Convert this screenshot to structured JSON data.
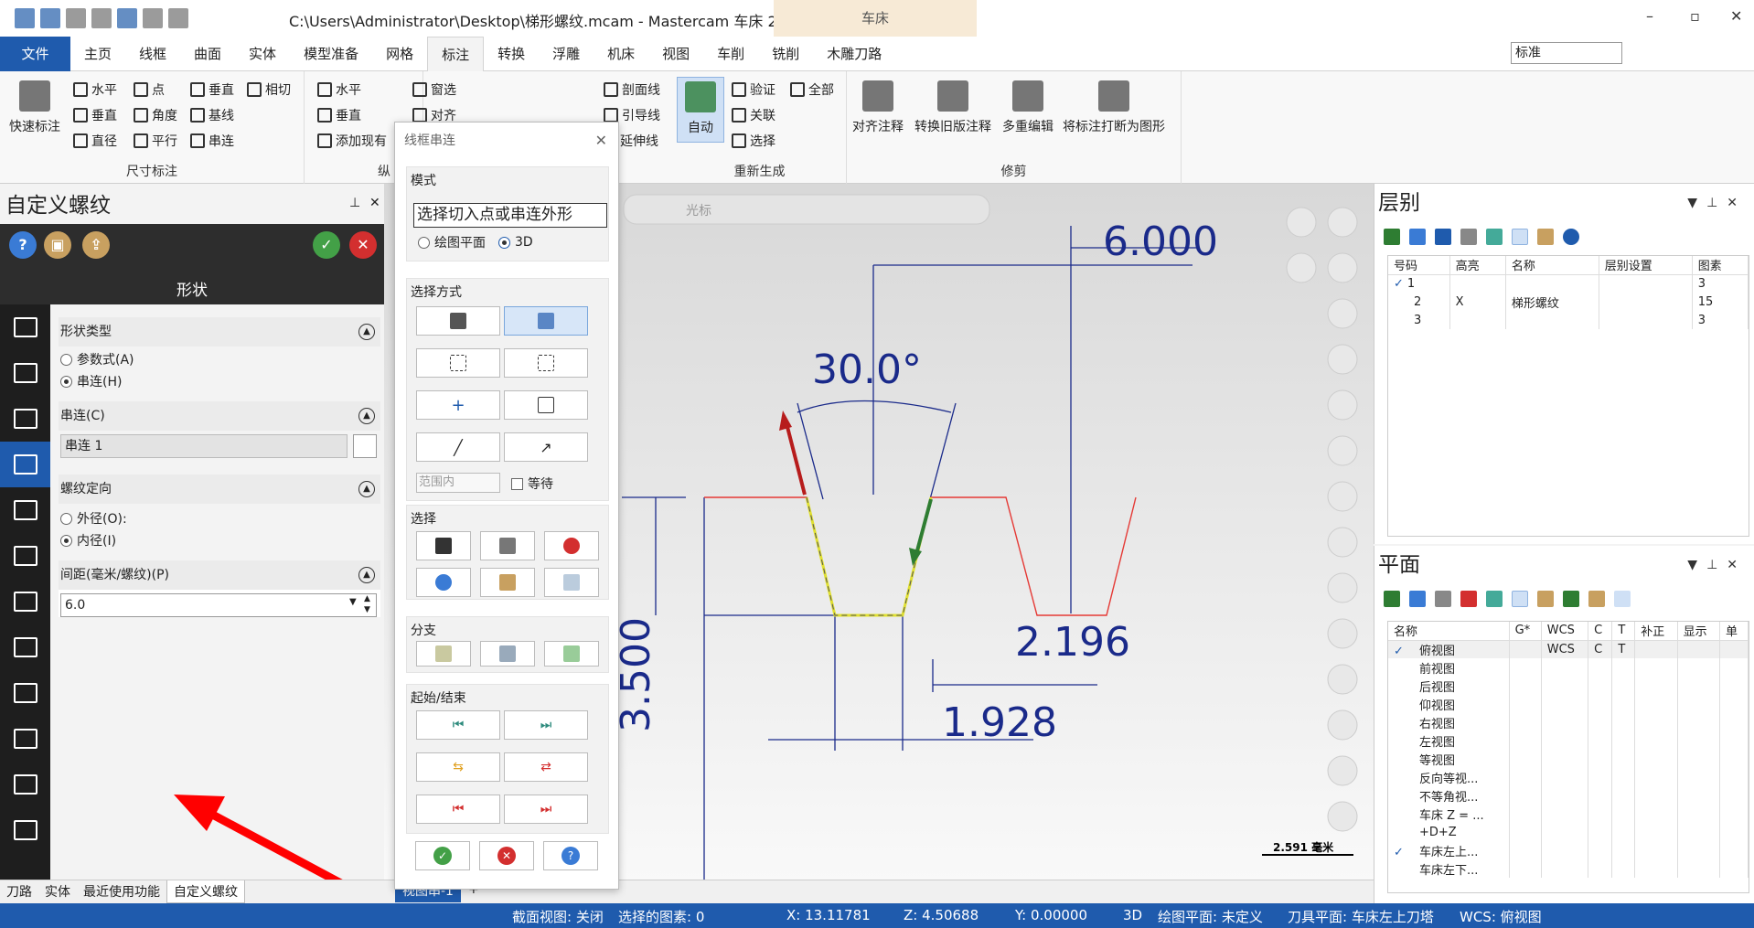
{
  "window": {
    "title": "C:\\Users\\Administrator\\Desktop\\梯形螺纹.mcam - Mastercam 车床 2025",
    "context_tab": "车床",
    "minimize": "–",
    "restore": "▫",
    "close": "✕"
  },
  "ribbon_tabs": [
    "文件",
    "主页",
    "线框",
    "曲面",
    "实体",
    "模型准备",
    "网格",
    "标注",
    "转换",
    "浮雕",
    "机床",
    "视图",
    "车削",
    "铣削",
    "木雕刀路"
  ],
  "active_tab": "标注",
  "style_select": "标准",
  "ribbon": {
    "quick_dim": "快速标注",
    "dims": [
      "水平",
      "点",
      "垂直",
      "相切",
      "垂直",
      "角度",
      "基线",
      "直径",
      "平行",
      "串连"
    ],
    "dim_group": "尺寸标注",
    "vert_items": [
      "水平",
      "垂直",
      "添加现有"
    ],
    "vert_group_partial": "纵",
    "window_items": [
      "窗选",
      "对齐"
    ],
    "section_items": [
      "剖面线",
      "引导线",
      "延伸线"
    ],
    "regen": {
      "auto": "自动",
      "items": [
        "验证",
        "全部",
        "关联",
        "选择"
      ],
      "group": "重新生成"
    },
    "trim": {
      "items": [
        "对齐注释",
        "转换旧版注释",
        "多重编辑",
        "将标注打断为图形"
      ],
      "group": "修剪"
    }
  },
  "left_panel": {
    "header": "自定义螺纹",
    "pin": "⊥",
    "close": "✕",
    "title": "形状",
    "shape_type": {
      "label": "形状类型",
      "options": [
        "参数式(A)",
        "串连(H)"
      ],
      "selected": 1
    },
    "chain": {
      "label": "串连(C)",
      "value": "串连 1"
    },
    "thread_dir": {
      "label": "螺纹定向",
      "options": [
        "外径(O):",
        "内径(I)"
      ],
      "selected": 1
    },
    "pitch": {
      "label": "间距(毫米/螺纹)(P)",
      "value": "6.0"
    }
  },
  "bottom_tabs": [
    "刀路",
    "实体",
    "最近使用功能",
    "自定义螺纹"
  ],
  "viewsheet_tab": "视图串-1",
  "dialog": {
    "title": "线框串连",
    "mode_label": "模式",
    "tooltip": "选择切入点或串连外形",
    "plane_options": [
      "绘图平面",
      "3D"
    ],
    "select_method_label": "选择方式",
    "range": "范围内",
    "wait": "等待",
    "select_label": "选择",
    "branch_label": "分支",
    "start_end_label": "起始/结束"
  },
  "viewport": {
    "toolbar_cursor": "光标",
    "dims": {
      "top": "6.000",
      "angle": "30.0°",
      "right": "2.196",
      "bottom": "1.928",
      "left": "3.500"
    },
    "scale": "2.591 毫米"
  },
  "layers": {
    "title": "层别",
    "columns": [
      "号码",
      "高亮",
      "名称",
      "层别设置",
      "图素"
    ],
    "rows": [
      {
        "check": "✓",
        "num": "1",
        "high": "",
        "name": "",
        "set": "",
        "count": "3"
      },
      {
        "check": "",
        "num": "2",
        "high": "X",
        "name": "梯形螺纹",
        "set": "",
        "count": "15"
      },
      {
        "check": "",
        "num": "3",
        "high": "",
        "name": "",
        "set": "",
        "count": "3"
      }
    ]
  },
  "planes": {
    "title": "平面",
    "columns": [
      "名称",
      "G*",
      "WCS",
      "C",
      "T",
      "补正",
      "显示",
      "单"
    ],
    "rows": [
      {
        "check": "✓",
        "name": "俯视图",
        "wcs": "WCS",
        "c": "C",
        "t": "T"
      },
      {
        "check": "",
        "name": "前视图",
        "wcs": "",
        "c": "",
        "t": ""
      },
      {
        "check": "",
        "name": "后视图",
        "wcs": "",
        "c": "",
        "t": ""
      },
      {
        "check": "",
        "name": "仰视图",
        "wcs": "",
        "c": "",
        "t": ""
      },
      {
        "check": "",
        "name": "右视图",
        "wcs": "",
        "c": "",
        "t": ""
      },
      {
        "check": "",
        "name": "左视图",
        "wcs": "",
        "c": "",
        "t": ""
      },
      {
        "check": "",
        "name": "等视图",
        "wcs": "",
        "c": "",
        "t": ""
      },
      {
        "check": "",
        "name": "反向等视...",
        "wcs": "",
        "c": "",
        "t": ""
      },
      {
        "check": "",
        "name": "不等角视...",
        "wcs": "",
        "c": "",
        "t": ""
      },
      {
        "check": "",
        "name": "车床 Z = ...",
        "wcs": "",
        "c": "",
        "t": ""
      },
      {
        "check": "",
        "name": "+D+Z",
        "wcs": "",
        "c": "",
        "t": ""
      },
      {
        "check": "✓",
        "name": "车床左上...",
        "wcs": "",
        "c": "",
        "t": ""
      },
      {
        "check": "",
        "name": "车床左下...",
        "wcs": "",
        "c": "",
        "t": ""
      }
    ]
  },
  "status": {
    "section_view": "截面视图: 关闭",
    "selected": "选择的图素: 0",
    "x": "X:   13.11781",
    "z": "Z:   4.50688",
    "y": "Y:   0.00000",
    "mode": "3D",
    "draw_plane": "绘图平面: 未定义",
    "tool_plane": "刀具平面: 车床左上刀塔",
    "wcs": "WCS: 俯视图"
  },
  "colors": {
    "brand": "#1f5bad",
    "accent_red": "#d32f2f",
    "ok_green": "#43a047"
  }
}
